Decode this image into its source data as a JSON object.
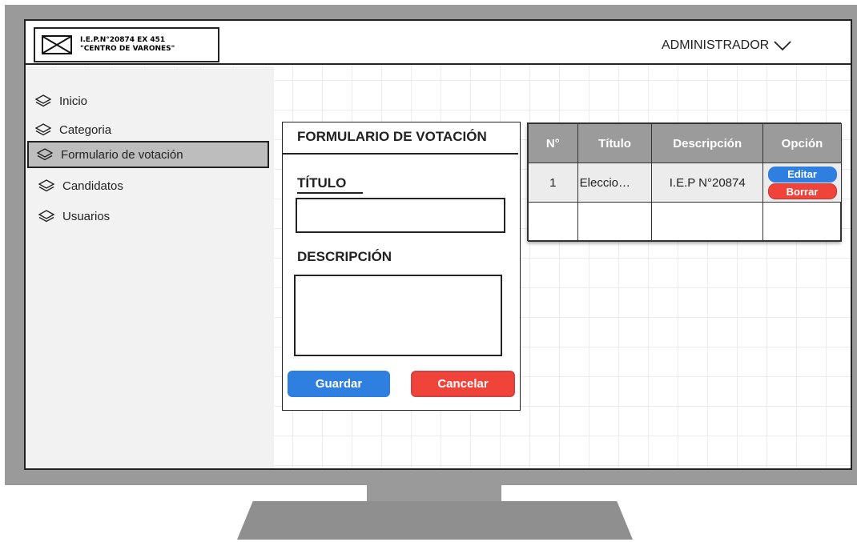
{
  "header": {
    "logo_line1": "I.E.P.N°20874   EX   451",
    "logo_line2": "\"CENTRO DE VARONES\"",
    "user_label": "ADMINISTRADOR"
  },
  "sidebar": {
    "items": [
      {
        "label": "Inicio",
        "icon": "layers-icon"
      },
      {
        "label": "Categoria",
        "icon": "layers-icon"
      },
      {
        "label": "Formulario de votación",
        "icon": "layers-icon",
        "active": true
      },
      {
        "label": "Candidatos",
        "icon": "layers-icon"
      },
      {
        "label": "Usuarios",
        "icon": "layers-icon"
      }
    ]
  },
  "form": {
    "title": "FORMULARIO DE VOTACIÓN",
    "title_field_label": "TÍTULO",
    "title_field_value": "",
    "description_field_label": "DESCRIPCIÓN",
    "description_field_value": "",
    "save_label": "Guardar",
    "cancel_label": "Cancelar"
  },
  "table": {
    "headers": [
      "N°",
      "Título",
      "Descripción",
      "Opción"
    ],
    "rows": [
      {
        "n": "1",
        "titulo": "Eleccio…",
        "descripcion": "I.E.P N°20874",
        "edit_label": "Editar",
        "delete_label": "Borrar"
      }
    ]
  },
  "colors": {
    "primary_blue": "#2e7fe0",
    "danger_red": "#f0433a",
    "table_header": "#9b9b9b",
    "sidebar_active": "#bdbdbd"
  }
}
